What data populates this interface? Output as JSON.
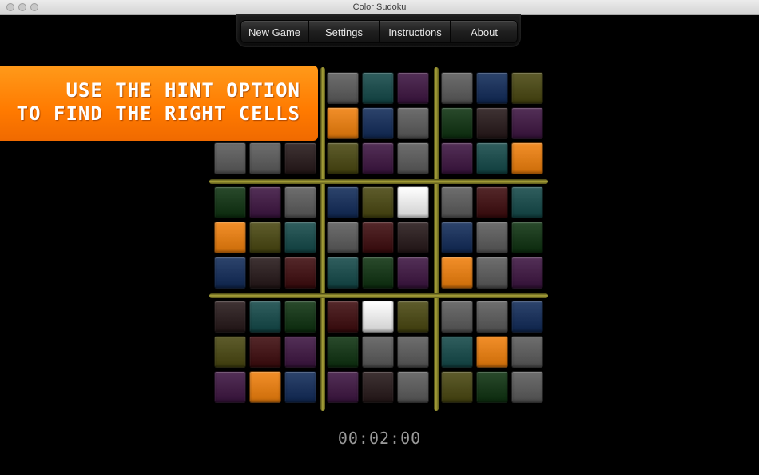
{
  "window": {
    "title": "Color Sudoku"
  },
  "menu": {
    "items": [
      "New Game",
      "Settings",
      "Instructions",
      "About"
    ]
  },
  "hint": {
    "line1": "USE THE HINT OPTION",
    "line2": "TO FIND THE RIGHT CELLS"
  },
  "timer": "00:02:00",
  "colors": {
    "D": "#5a5a5a",
    "T": "#134848",
    "P": "#3c1440",
    "B": "#102a58",
    "Y": "#48460f",
    "O": "#f07f0b",
    "G": "#0d310f",
    "R": "#3d0a0d",
    "K": "#251718",
    "W": "#e6e6e6",
    "E": "#00000000"
  },
  "board": [
    [
      "E",
      "E",
      "E",
      "D",
      "T",
      "P",
      "D",
      "B",
      "Y"
    ],
    [
      "E",
      "E",
      "E",
      "O",
      "B",
      "D",
      "G",
      "K",
      "P"
    ],
    [
      "D",
      "D",
      "K",
      "Y",
      "P",
      "D",
      "P",
      "T",
      "O"
    ],
    [
      "G",
      "P",
      "D",
      "B",
      "Y",
      "W",
      "D",
      "R",
      "T"
    ],
    [
      "O",
      "Y",
      "T",
      "D",
      "R",
      "K",
      "B",
      "D",
      "G"
    ],
    [
      "B",
      "K",
      "R",
      "T",
      "G",
      "P",
      "O",
      "D",
      "P"
    ],
    [
      "K",
      "T",
      "G",
      "R",
      "W",
      "Y",
      "D",
      "D",
      "B"
    ],
    [
      "Y",
      "R",
      "P",
      "G",
      "D",
      "D",
      "T",
      "O",
      "D"
    ],
    [
      "P",
      "O",
      "B",
      "P",
      "K",
      "D",
      "Y",
      "G",
      "D"
    ]
  ]
}
